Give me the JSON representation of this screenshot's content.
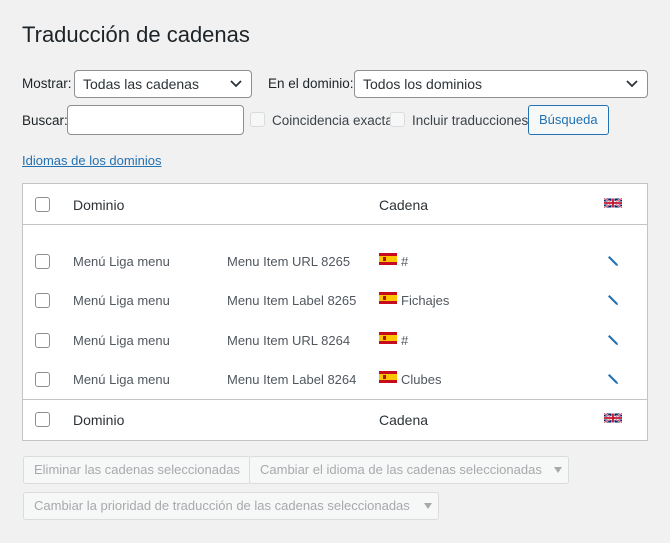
{
  "page": {
    "title": "Traducción de cadenas"
  },
  "filters": {
    "show_label": "Mostrar:",
    "show_value": "Todas las cadenas",
    "domain_label": "En el dominio:",
    "domain_value": "Todos los dominios",
    "search_label": "Buscar:",
    "search_value": "",
    "exact_match_label": "Coincidencia exacta",
    "include_translations_label": "Incluir traducciones",
    "search_button": "Búsqueda"
  },
  "domain_languages_link": "Idiomas de los dominios",
  "table": {
    "header": {
      "domain": "Dominio",
      "string": "Cadena",
      "language_icon": "uk-flag-icon"
    },
    "footer": {
      "domain": "Dominio",
      "string": "Cadena",
      "language_icon": "uk-flag-icon"
    },
    "rows": [
      {
        "domain": "Menú Liga menu",
        "name": "Menu Item URL 8265",
        "flag": "es-flag-icon",
        "value": "#"
      },
      {
        "domain": "Menú Liga menu",
        "name": "Menu Item Label 8265",
        "flag": "es-flag-icon",
        "value": "Fichajes"
      },
      {
        "domain": "Menú Liga menu",
        "name": "Menu Item URL 8264",
        "flag": "es-flag-icon",
        "value": "#"
      },
      {
        "domain": "Menú Liga menu",
        "name": "Menu Item Label 8264",
        "flag": "es-flag-icon",
        "value": "Clubes"
      }
    ]
  },
  "bulk_actions": {
    "delete": "Eliminar las cadenas seleccionadas",
    "change_language": "Cambiar el idioma de las cadenas seleccionadas",
    "change_priority": "Cambiar la prioridad de traducción de las cadenas seleccionadas"
  },
  "colors": {
    "accent": "#2271b1",
    "background": "#f1f1f1",
    "border": "#c3c4c7"
  }
}
